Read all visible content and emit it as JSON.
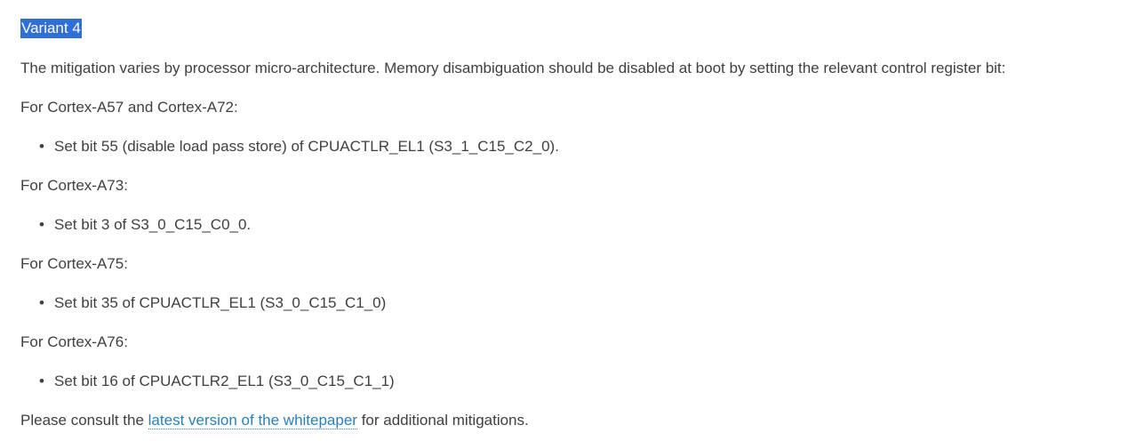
{
  "heading": "Variant 4",
  "intro": "The mitigation varies by processor micro-architecture. Memory disambiguation should be disabled at boot by setting the relevant control register bit:",
  "groups": [
    {
      "label": "For Cortex-A57 and Cortex-A72:",
      "item": "Set bit 55 (disable load pass store) of CPUACTLR_EL1 (S3_1_C15_C2_0)."
    },
    {
      "label": "For Cortex-A73:",
      "item": "Set bit 3 of S3_0_C15_C0_0."
    },
    {
      "label": "For Cortex-A75:",
      "item": "Set bit 35 of CPUACTLR_EL1 (S3_0_C15_C1_0)"
    },
    {
      "label": "For Cortex-A76:",
      "item": "Set bit 16 of CPUACTLR2_EL1 (S3_0_C15_C1_1)"
    }
  ],
  "footer": {
    "prefix": "Please consult the ",
    "link_text": "latest version of the whitepaper",
    "suffix": " for additional mitigations."
  },
  "bullet_glyph": "•",
  "colors": {
    "text": "#404040",
    "link": "#2980b9",
    "highlight": "#2f6fd6"
  }
}
